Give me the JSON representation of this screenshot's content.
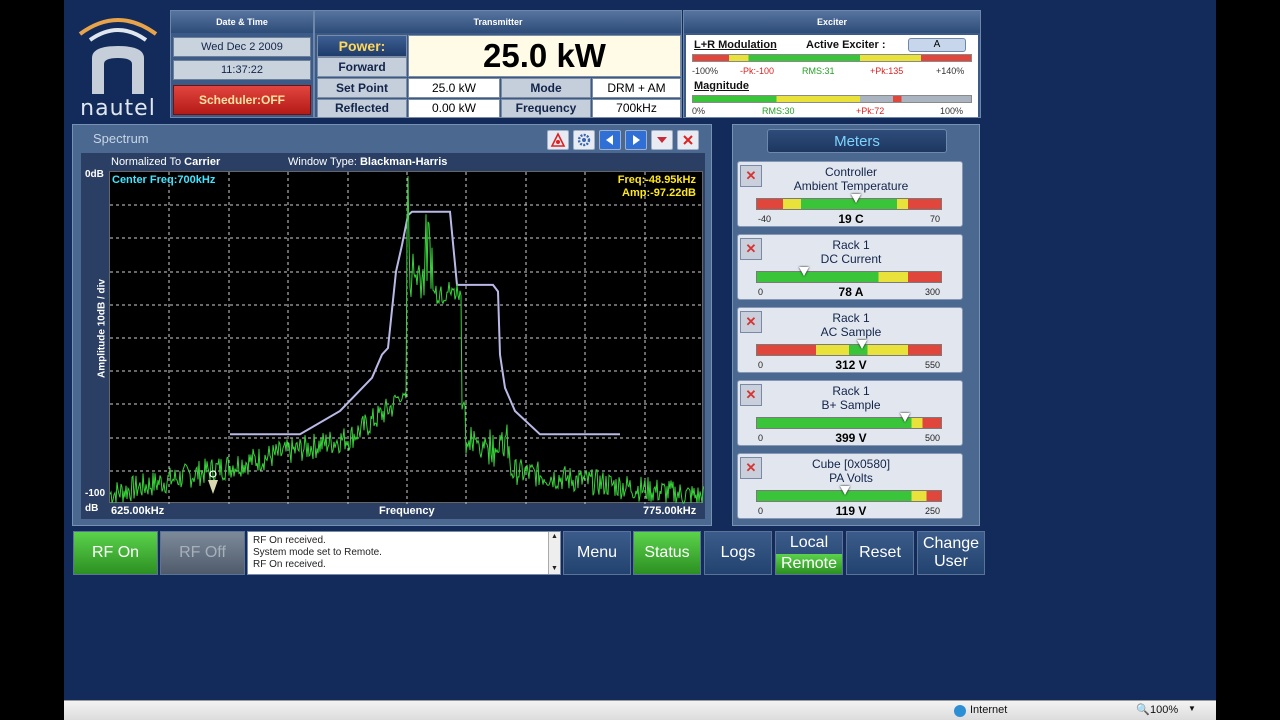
{
  "brand": {
    "logo_text": "nautel"
  },
  "datetime": {
    "title": "Date & Time",
    "date": "Wed Dec 2 2009",
    "time": "11:37:22",
    "scheduler": "Scheduler:OFF"
  },
  "transmitter": {
    "title": "Transmitter",
    "power_label": "Power:",
    "power_value": "25.0 kW",
    "rows": [
      {
        "label": "Forward",
        "value": ""
      },
      {
        "label": "Set Point",
        "value": "25.0 kW",
        "label2": "Mode",
        "value2": "DRM + AM"
      },
      {
        "label": "Reflected",
        "value": "0.00 kW",
        "label2": "Frequency",
        "value2": "700kHz"
      }
    ]
  },
  "exciter": {
    "title": "Exciter",
    "modulation_label": "L+R Modulation",
    "active_label": "Active Exciter :",
    "active_value": "A",
    "mod_scale": {
      "min": "-100%",
      "pk_neg": "-Pk:-100",
      "rms": "RMS:31",
      "pk_pos": "+Pk:135",
      "max": "+140%"
    },
    "magnitude_label": "Magnitude",
    "mag_scale": {
      "min": "0%",
      "rms": "RMS:30",
      "pk": "+Pk:72",
      "max": "100%"
    },
    "colors": {
      "green": "#39c43a",
      "yellow": "#e8e23b",
      "red": "#e0463c"
    }
  },
  "spectrum": {
    "title": "Spectrum",
    "normalized_label": "Normalized To",
    "normalized_value": "Carrier",
    "window_label": "Window Type:",
    "window_value": "Blackman-Harris",
    "center_freq": "Center Freq:700kHz",
    "freq_readout_label": "Freq:",
    "freq_readout": "-48.95kHz",
    "amp_readout_label": "Amp:",
    "amp_readout": "-97.22dB",
    "y_top": "0dB",
    "y_bottom": "-100",
    "y_unit": "dB",
    "y_axis_label": "Amplitude 10dB / div",
    "x_left": "625.00kHz",
    "x_center": "Frequency",
    "x_right": "775.00kHz",
    "toolbar_icons": [
      "alarm-icon",
      "settings-icon",
      "arrow-left-icon",
      "arrow-right-icon",
      "dropdown-icon",
      "close-icon"
    ]
  },
  "meters": {
    "title": "Meters",
    "items": [
      {
        "line1": "Controller",
        "line2": "Ambient Temperature",
        "min": "-40",
        "max": "70",
        "value": "19 C",
        "level": 0.54
      },
      {
        "line1": "Rack 1",
        "line2": "DC Current",
        "min": "0",
        "max": "300",
        "value": "78 A",
        "level": 0.26
      },
      {
        "line1": "Rack 1",
        "line2": "AC Sample",
        "min": "0",
        "max": "550",
        "value": "312 V",
        "level": 0.57
      },
      {
        "line1": "Rack 1",
        "line2": "B+ Sample",
        "min": "0",
        "max": "500",
        "value": "399 V",
        "level": 0.8
      },
      {
        "line1": "Cube [0x0580]",
        "line2": "PA Volts",
        "min": "0",
        "max": "250",
        "value": "119 V",
        "level": 0.48
      }
    ]
  },
  "buttons": {
    "rf_on": "RF On",
    "rf_off": "RF Off",
    "menu": "Menu",
    "status": "Status",
    "logs": "Logs",
    "local": "Local",
    "remote": "Remote",
    "reset": "Reset",
    "change_user_1": "Change",
    "change_user_2": "User"
  },
  "log": [
    "RF On received.",
    "System mode set to Remote.",
    "RF On received."
  ],
  "statusbar": {
    "zone": "Internet",
    "zoom": "100%"
  }
}
